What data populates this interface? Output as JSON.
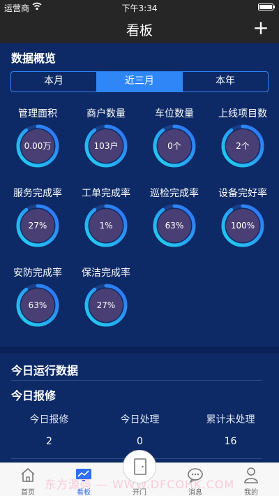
{
  "status": {
    "carrier": "运营商",
    "time": "下午3:34"
  },
  "nav": {
    "title": "看板",
    "plus": "+"
  },
  "overview": {
    "title": "数据概览",
    "segments": [
      {
        "label": "本月",
        "active": false
      },
      {
        "label": "近三月",
        "active": true
      },
      {
        "label": "本年",
        "active": false
      }
    ],
    "metrics": [
      {
        "label": "管理面积",
        "value": "0.00万",
        "level": 0.9
      },
      {
        "label": "商户数量",
        "value": "103户",
        "level": 0.9
      },
      {
        "label": "车位数量",
        "value": "0个",
        "level": 0.9
      },
      {
        "label": "上线项目数",
        "value": "2个",
        "level": 0.9
      },
      {
        "label": "服务完成率",
        "value": "27%",
        "level": 0.9
      },
      {
        "label": "工单完成率",
        "value": "1%",
        "level": 0.9
      },
      {
        "label": "巡检完成率",
        "value": "63%",
        "level": 0.9
      },
      {
        "label": "设备完好率",
        "value": "100%",
        "level": 0.9
      },
      {
        "label": "安防完成率",
        "value": "63%",
        "level": 0.9
      },
      {
        "label": "保洁完成率",
        "value": "27%",
        "level": 0.9
      }
    ]
  },
  "today": {
    "title": "今日运行数据",
    "repair_title": "今日报修",
    "stats": [
      {
        "label": "今日报修",
        "value": "2"
      },
      {
        "label": "今日处理",
        "value": "0"
      },
      {
        "label": "累计未处理",
        "value": "16"
      }
    ]
  },
  "tabbar": {
    "items": [
      "首页",
      "看板",
      "开门",
      "消息",
      "我的"
    ],
    "active_color": "#2f6ef6"
  },
  "watermark": "东方源码 — WWW.DFCOHK.COM",
  "colors": {
    "accent": "#2f86f6",
    "ring_start": "#22d3ee",
    "ring_end": "#2f6ef6",
    "bg": "#0d2a66"
  }
}
